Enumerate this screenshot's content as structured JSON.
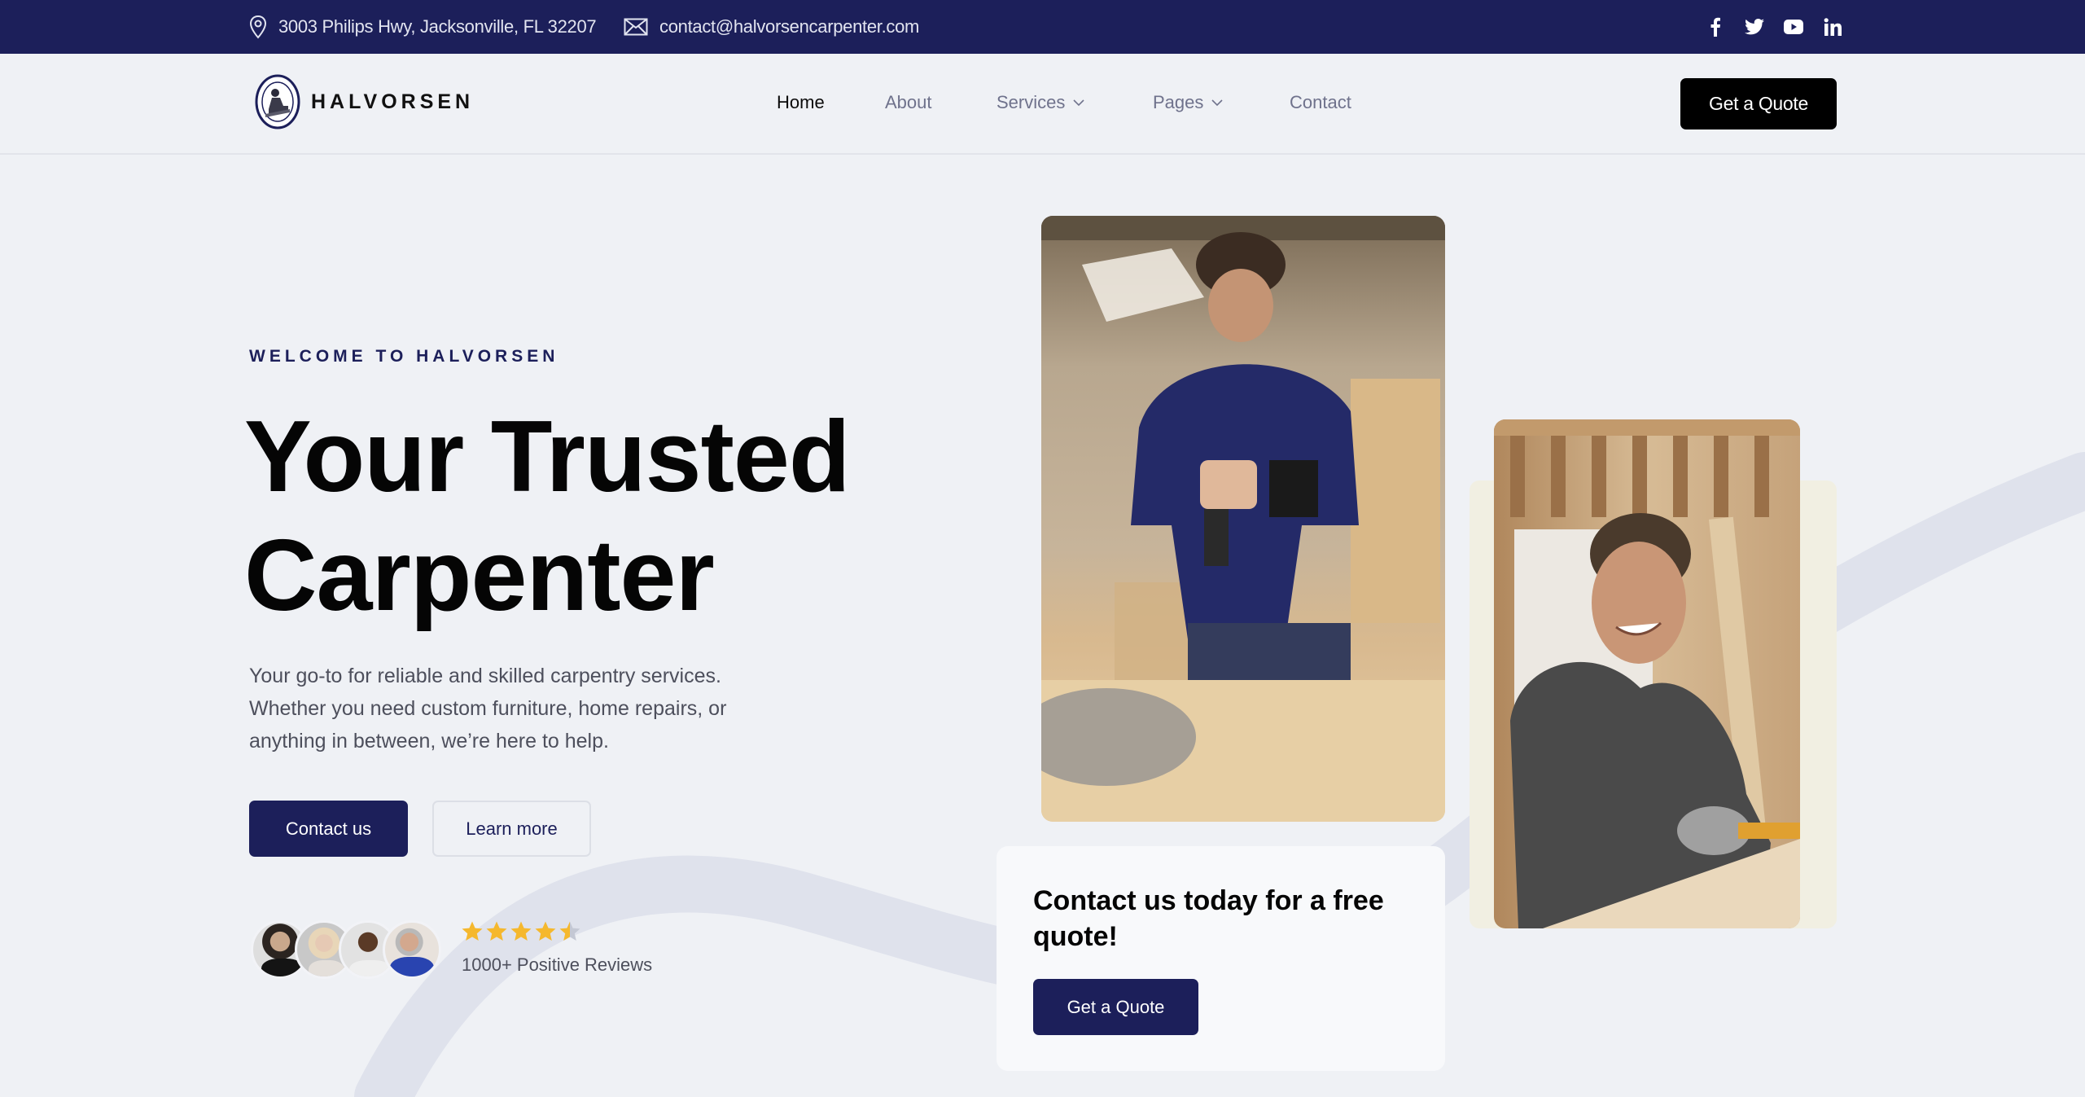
{
  "topbar": {
    "address": "3003 Philips Hwy, Jacksonville, FL 32207",
    "email": "contact@halvorsencarpenter.com",
    "social": [
      "facebook-icon",
      "twitter-icon",
      "youtube-icon",
      "linkedin-icon"
    ]
  },
  "brand": {
    "name": "HALVORSEN",
    "logo_icon": "carpenter-badge-icon"
  },
  "nav": {
    "items": [
      {
        "label": "Home",
        "active": true
      },
      {
        "label": "About",
        "active": false
      },
      {
        "label": "Services",
        "has_dropdown": true
      },
      {
        "label": "Pages",
        "has_dropdown": true
      },
      {
        "label": "Contact",
        "active": false
      }
    ],
    "cta": "Get a Quote"
  },
  "hero": {
    "eyebrow": "WELCOME TO HALVORSEN",
    "title_line1": "Your Trusted",
    "title_line2": "Carpenter",
    "lead": "Your go-to for reliable and skilled carpentry services. Whether you need custom furniture, home repairs, or anything in between, we’re here to help.",
    "primary_button": "Contact us",
    "secondary_button": "Learn more",
    "rating": 4.5,
    "rating_max": 5,
    "reviews_label": "1000+ Positive Reviews",
    "avatar_count": 4
  },
  "card": {
    "title": "Contact us today for a free quote!",
    "button": "Get a Quote"
  },
  "colors": {
    "navy": "#1c1f5a",
    "background": "#eff1f5",
    "star": "#f5b82e",
    "star_empty": "#c4c8d4",
    "muted_text": "#6f728c"
  }
}
